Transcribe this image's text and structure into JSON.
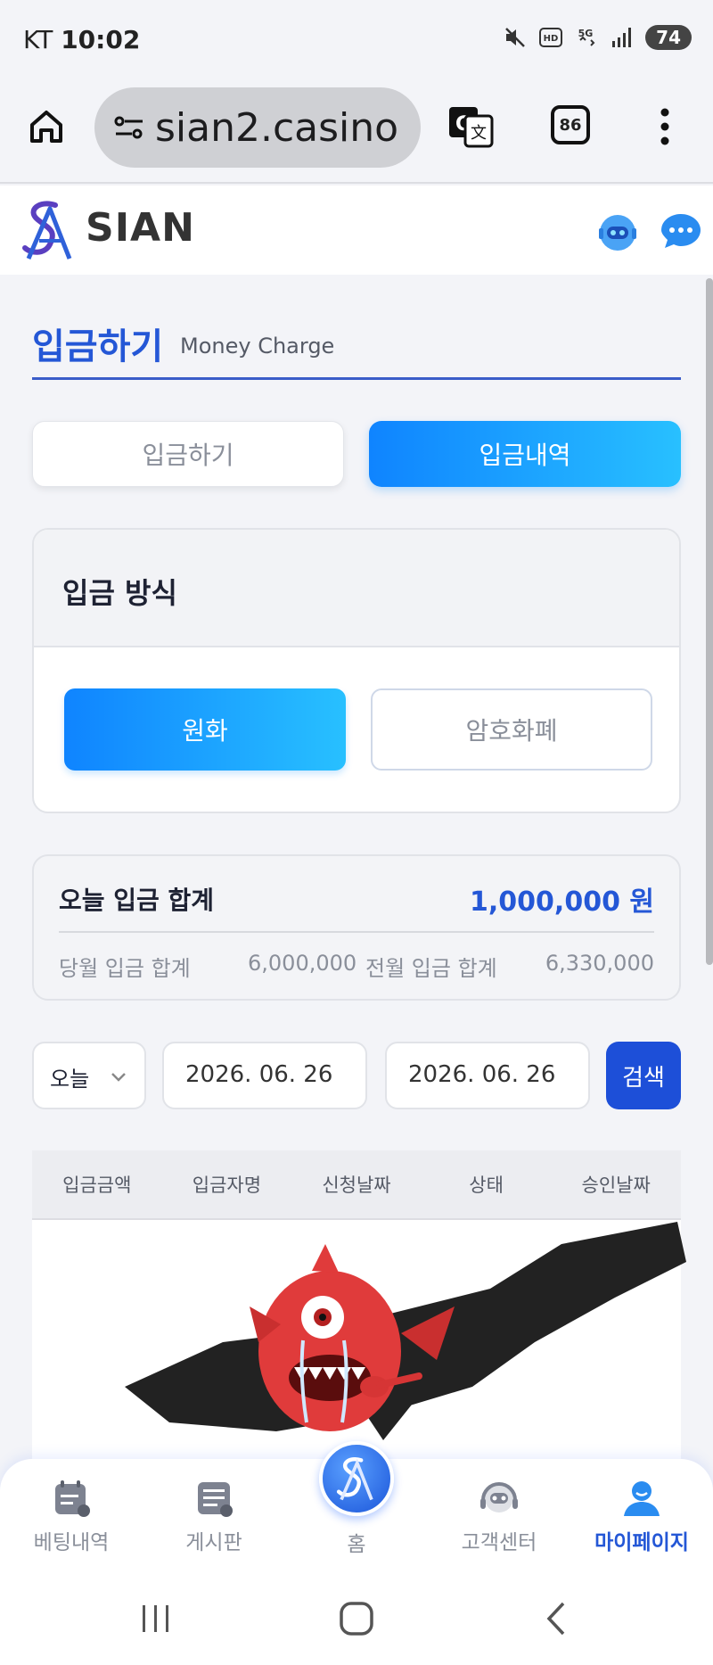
{
  "status_bar": {
    "carrier": "KT",
    "time": "10:02",
    "battery": "74"
  },
  "browser": {
    "url": "sian2.casino",
    "tab_count": "86"
  },
  "site": {
    "logo_text": "SIAN"
  },
  "page": {
    "title": "입금하기",
    "subtitle": "Money Charge"
  },
  "tabs": {
    "deposit": "입금하기",
    "history": "입금내역"
  },
  "method": {
    "title": "입금 방식",
    "won": "원화",
    "crypto": "암호화폐"
  },
  "summary": {
    "today_label": "오늘 입금 합계",
    "today_value": "1,000,000 원",
    "month_label": "당월 입금 합계",
    "month_value": "6,000,000",
    "prev_label": "전월 입금 합계",
    "prev_value": "6,330,000"
  },
  "filter": {
    "period": "오늘",
    "start_date": "2026. 06. 26",
    "end_date": "2026. 06. 26",
    "search": "검색"
  },
  "table": {
    "headers": [
      "입금금액",
      "입금자명",
      "신청날짜",
      "상태",
      "승인날짜"
    ]
  },
  "bottom_nav": {
    "items": [
      "베팅내역",
      "게시판",
      "홈",
      "고객센터",
      "마이페이지"
    ]
  },
  "colors": {
    "accent": "#2457d6",
    "gradient_start": "#0f84ff",
    "gradient_end": "#28c0ff"
  }
}
